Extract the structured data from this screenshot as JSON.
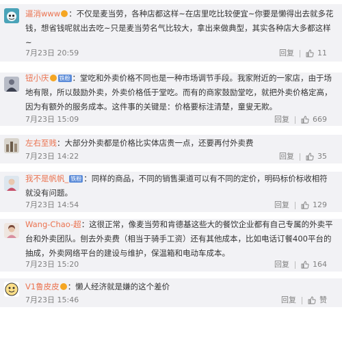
{
  "reply_label": "回复",
  "comments": [
    {
      "username": "逼消www",
      "tag": "",
      "text": "：不仅是麦当劳，各种店都这样~在店里吃比较便宜~你要是懒得出去就多花钱，想省钱呢就出去吃~只是麦当劳名气比较大，拿出来做典型，其实各种店大多都这样~",
      "time": "7月23日 20:59",
      "likes": "11"
    },
    {
      "username": "钮小庆",
      "tag": "铁粉",
      "text": "：堂吃和外卖价格不同也是一种市场调节手段。我家附近的一家店，由于场地有限，所以鼓励外卖，外卖价格低于堂吃。而有的商家鼓励堂吃，就把外卖价格定高，因为有额外的服务成本。这件事的关键是：价格要标注清楚，童叟无欺。",
      "time": "7月23日 15:09",
      "likes": "669"
    },
    {
      "username": "左右至贱",
      "tag": "",
      "text": "：大部分外卖都是价格比实体店贵一点，还要再付外卖费",
      "time": "7月23日 14:22",
      "likes": "35"
    },
    {
      "username": "我不是帆帆_",
      "tag": "铁粉",
      "text": "：同样的商品，不同的销售渠道可以有不同的定价，明码标价标收相符就没有问题。",
      "time": "7月23日 14:54",
      "likes": "129"
    },
    {
      "username": "Wang-Chao-超",
      "tag": "",
      "text": "：这很正常，像麦当劳和肯德基这些大的餐饮企业都有自己专属的外卖平台和外卖团队。刨去外卖费（相当于骑手工资）还有其他成本，比如电话订餐400平台的抽成，外卖网络平台的建设与维护，保温箱和电动车成本。",
      "time": "7月23日 15:20",
      "likes": "164"
    },
    {
      "username": "V1鲁皮皮",
      "tag": "",
      "text": "：懒人经济就是嫌的这个差价",
      "time": "7月23日 15:46",
      "likes": "赞"
    }
  ]
}
